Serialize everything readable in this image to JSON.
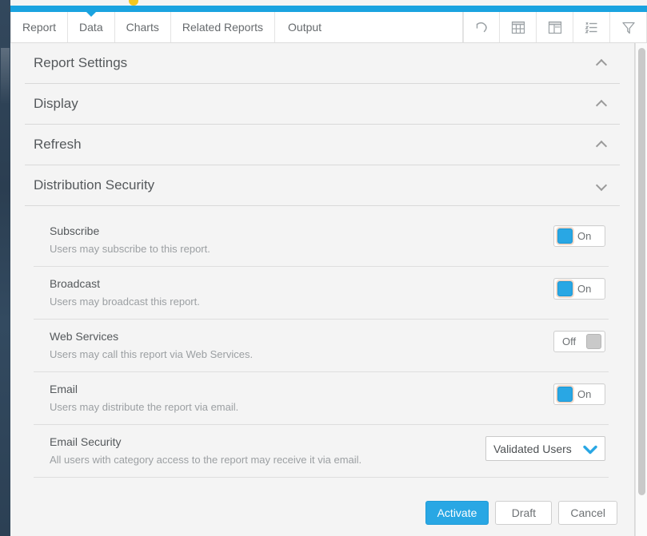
{
  "tabs": [
    {
      "label": "Report",
      "active": false
    },
    {
      "label": "Data",
      "active": true
    },
    {
      "label": "Charts",
      "active": false
    },
    {
      "label": "Related Reports",
      "active": false
    },
    {
      "label": "Output",
      "active": false
    }
  ],
  "toolbar": {
    "icons": [
      {
        "name": "undo-icon"
      },
      {
        "name": "table-icon"
      },
      {
        "name": "column-chart-icon"
      },
      {
        "name": "list-icon"
      },
      {
        "name": "filter-funnel-icon"
      }
    ]
  },
  "sections": [
    {
      "title": "Report Settings",
      "expanded": false
    },
    {
      "title": "Display",
      "expanded": false
    },
    {
      "title": "Refresh",
      "expanded": false
    },
    {
      "title": "Distribution Security",
      "expanded": true
    }
  ],
  "distribution_security": {
    "rows": [
      {
        "label": "Subscribe",
        "description": "Users may subscribe to this report.",
        "control": "toggle",
        "state": "On"
      },
      {
        "label": "Broadcast",
        "description": "Users may broadcast this report.",
        "control": "toggle",
        "state": "On"
      },
      {
        "label": "Web Services",
        "description": "Users may call this report via Web Services.",
        "control": "toggle",
        "state": "Off"
      },
      {
        "label": "Email",
        "description": "Users may distribute the report via email.",
        "control": "toggle",
        "state": "On"
      },
      {
        "label": "Email Security",
        "description": "All users with category access to the report may receive it via email.",
        "control": "select",
        "state": "Validated Users"
      }
    ]
  },
  "footer": {
    "activate_label": "Activate",
    "draft_label": "Draft",
    "cancel_label": "Cancel"
  },
  "colors": {
    "accent_blue": "#29a7e4",
    "top_bar_blue": "#1aa3e0",
    "rail_navy": "#2e4256",
    "speck_yellow": "#f3c720",
    "panel_bg": "#f4f4f4"
  }
}
